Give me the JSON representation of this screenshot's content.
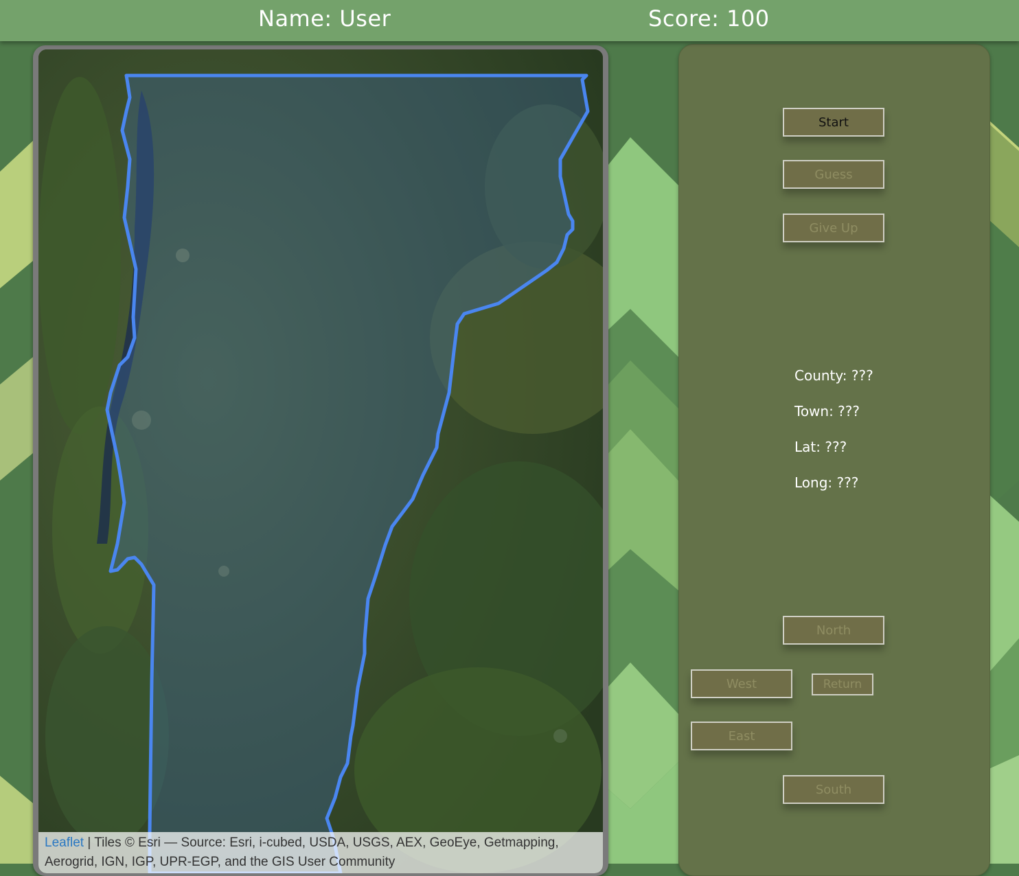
{
  "header": {
    "name_text": "Name: User",
    "score_text": "Score: 100"
  },
  "map": {
    "attribution_link": "Leaflet",
    "attribution_text": "| Tiles © Esri — Source: Esri, i-cubed, USDA, USGS, AEX, GeoEye, Getmapping, Aerogrid, IGN, IGP, UPR-EGP, and the GIS User Community",
    "outline_color": "#4a86f0"
  },
  "controls": {
    "start": "Start",
    "guess": "Guess",
    "give_up": "Give Up",
    "north": "North",
    "west": "West",
    "return": "Return",
    "east": "East",
    "south": "South"
  },
  "info": {
    "county": "County: ???",
    "town": "Town: ???",
    "lat": "Lat: ???",
    "long": "Long: ???"
  },
  "colors": {
    "topbar": "#74a26b",
    "panel": "#647249",
    "button": "#706e48"
  }
}
